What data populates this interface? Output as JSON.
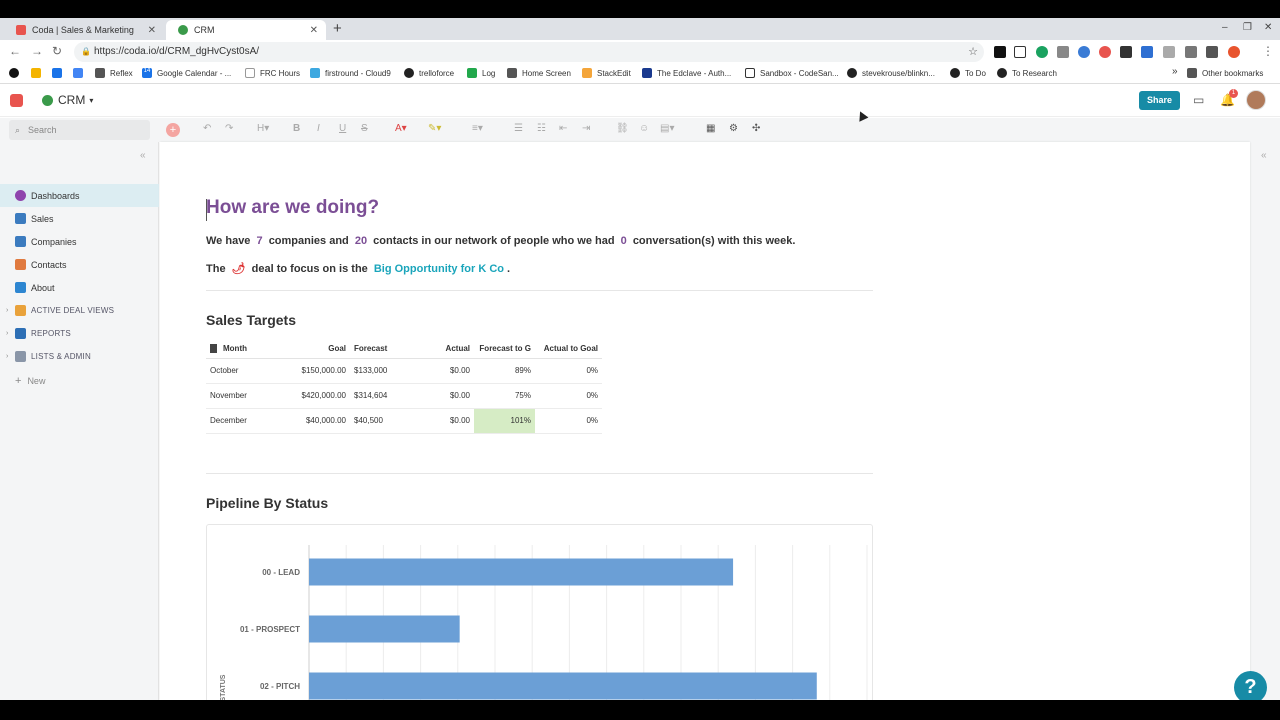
{
  "browser": {
    "tabs": [
      {
        "title": "Coda | Sales & Marketing",
        "active": false
      },
      {
        "title": "CRM",
        "active": true
      }
    ],
    "url": "https://coda.io/d/CRM_dgHvCyst0sA/",
    "bookmarks": [
      "Reflex",
      "Google Calendar - ...",
      "FRC Hours",
      "firstround - Cloud9",
      "trelloforce",
      "Log",
      "Home Screen",
      "StackEdit",
      "The Edclave - Auth...",
      "Sandbox - CodeSan...",
      "stevekrouse/blinkn...",
      "To Do",
      "To Research"
    ],
    "other_bookmarks": "Other bookmarks",
    "calendar_badge": "14",
    "bookmark_chevron": "»"
  },
  "header": {
    "doc_title": "CRM",
    "share_label": "Share",
    "notification_count": "1"
  },
  "search": {
    "placeholder": "Search"
  },
  "sidebar": {
    "items": [
      {
        "label": "Dashboards",
        "icon": "pie-chart-icon",
        "color": "#8e44ad"
      },
      {
        "label": "Sales",
        "icon": "people-icon",
        "color": "#3b7bbf"
      },
      {
        "label": "Companies",
        "icon": "buildings-icon",
        "color": "#3b7bbf"
      },
      {
        "label": "Contacts",
        "icon": "contacts-icon",
        "color": "#e07a3f"
      },
      {
        "label": "About",
        "icon": "info-icon",
        "color": "#2d86d1"
      }
    ],
    "sections": [
      "ACTIVE DEAL VIEWS",
      "REPORTS",
      "LISTS & ADMIN"
    ],
    "new_label": "New"
  },
  "page": {
    "title": "How are we doing?",
    "summary": {
      "p1": "We have",
      "companies": "7",
      "p2": "companies and",
      "contacts": "20",
      "p3": "contacts in our network of people who we had",
      "conversations": "0",
      "p4": "conversation(s) with this week."
    },
    "focus": {
      "p1": "The",
      "emoji": "🌶",
      "p2": "deal to focus on is the",
      "deal": "Big Opportunity for K Co",
      "p3": "."
    },
    "sales_targets_heading": "Sales Targets",
    "pipeline_heading": "Pipeline By Status"
  },
  "sales_table": {
    "headers": [
      "Month",
      "Goal",
      "Forecast",
      "Actual",
      "Forecast to G",
      "Actual to Goal"
    ],
    "rows": [
      [
        "October",
        "$150,000.00",
        "$133,000",
        "$0.00",
        "89%",
        "0%"
      ],
      [
        "November",
        "$420,000.00",
        "$314,604",
        "$0.00",
        "75%",
        "0%"
      ],
      [
        "December",
        "$40,000.00",
        "$40,500",
        "$0.00",
        "101%",
        "0%"
      ]
    ]
  },
  "chart_data": {
    "type": "bar",
    "orientation": "horizontal",
    "title": "",
    "ylabel": "STATUS",
    "categories": [
      "00 - LEAD",
      "01 - PROSPECT",
      "02 - PITCH"
    ],
    "values": [
      0.76,
      0.27,
      0.91
    ],
    "xlim": [
      0,
      1
    ],
    "grid": true,
    "bar_color": "#6b9fd6"
  },
  "help_label": "?"
}
